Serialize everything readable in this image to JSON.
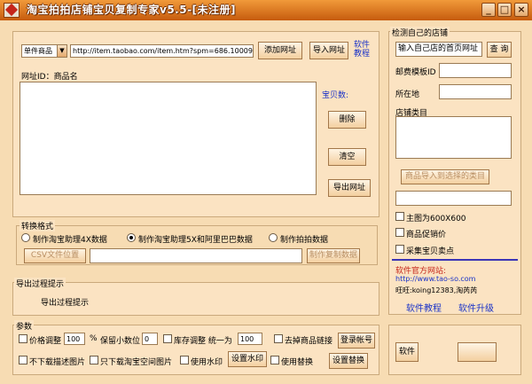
{
  "window": {
    "title": "淘宝拍拍店铺宝贝复制专家v5.5-[未注册]"
  },
  "top": {
    "source_type": "单件商品",
    "url_value": "http://item.taobao.com/item.htm?spm=686.1000925.1000",
    "add_url_label": "添加网址",
    "import_url_label": "导入网址",
    "tutorial_link_label": "软件教程"
  },
  "list": {
    "header": "网址ID：商品名",
    "item_count_label": "宝贝数:",
    "delete_label": "删除",
    "clear_label": "清空",
    "export_label": "导出网址"
  },
  "convert": {
    "title": "转换格式",
    "options": [
      "制作淘宝助理4X数据",
      "制作淘宝助理5X和阿里巴巴数据",
      "制作拍拍数据"
    ],
    "csv_button_label": "CSV文件位置",
    "csv_path": "",
    "make_copy_label": "制作复制数据"
  },
  "export_hint": {
    "title": "导出过程提示",
    "message": "导出过程提示"
  },
  "params": {
    "title": "参数",
    "price_adjust_label": "价格调整",
    "price_value": "100",
    "percent_symbol": "%",
    "decimal_label": "保留小数位",
    "decimal_value": "0",
    "stock_label": "库存调整 统一为",
    "stock_value": "100",
    "remove_links_label": "去掉商品链接",
    "login_label": "登录帐号",
    "no_desc_label": "不下载描述图片",
    "only_space_label": "只下载淘宝空间图片",
    "watermark_label": "使用水印",
    "set_watermark_label": "设置水印",
    "replace_label": "使用替换",
    "set_replace_label": "设置替换"
  },
  "shop": {
    "title": "检测自己的店铺",
    "shop_url_value": "输入自己店的首页网址",
    "query_label": "查 询",
    "postage_label": "邮费模板ID",
    "location_label": "所在地",
    "category_label": "店铺类目",
    "import_category_label": "商品导入到选择的类目",
    "main_image_label": "主图为600X600",
    "promo_price_label": "商品促销价",
    "collect_selling_label": "采集宝贝卖点"
  },
  "info": {
    "site_label": "软件官方网站:",
    "site_url": "http://www.tao-so.com",
    "wangwang": "旺旺:koing12383,淘芮芮",
    "tutorial_label": "软件教程",
    "upgrade_label": "软件升级"
  },
  "bottom_right": {
    "button_label": "软件"
  },
  "colors": {
    "title_gradient_top": "#f19a3a",
    "title_gradient_bottom": "#c65b0d",
    "body": "#f7dcb3",
    "link": "#1a33c8",
    "accent_red": "#c5261b"
  }
}
